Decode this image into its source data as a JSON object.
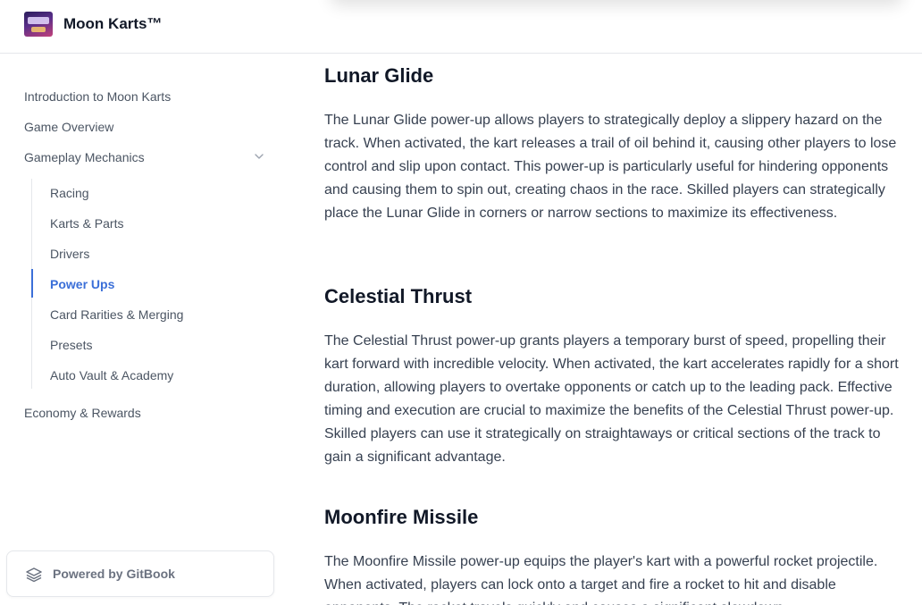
{
  "header": {
    "site_title": "Moon Karts™",
    "logo_icon": "moon-karts-logo"
  },
  "sidebar": {
    "items": [
      {
        "label": "Introduction to Moon Karts"
      },
      {
        "label": "Game Overview"
      },
      {
        "label": "Gameplay Mechanics",
        "expanded": true
      },
      {
        "label": "Economy & Rewards"
      }
    ],
    "subitems": [
      {
        "label": "Racing"
      },
      {
        "label": "Karts & Parts"
      },
      {
        "label": "Drivers"
      },
      {
        "label": "Power Ups",
        "active": true
      },
      {
        "label": "Card Rarities & Merging"
      },
      {
        "label": "Presets"
      },
      {
        "label": "Auto Vault & Academy"
      }
    ],
    "gitbook_label": "Powered by GitBook"
  },
  "content": {
    "sections": [
      {
        "heading": "Lunar Glide",
        "text": "The Lunar Glide power-up allows players to strategically deploy a slippery hazard on the track. When activated, the kart releases a trail of oil behind it, causing other players to lose control and slip upon contact. This power-up is particularly useful for hindering opponents and causing them to spin out, creating chaos in the race. Skilled players can strategically place the Lunar Glide in corners or narrow sections to maximize its effectiveness."
      },
      {
        "heading": "Celestial Thrust",
        "text": "The Celestial Thrust power-up grants players a temporary burst of speed, propelling their kart forward with incredible velocity. When activated, the kart accelerates rapidly for a short duration, allowing players to overtake opponents or catch up to the leading pack. Effective timing and execution are crucial to maximize the benefits of the Celestial Thrust power-up. Skilled players can use it strategically on straightaways or critical sections of the track to gain a significant advantage."
      },
      {
        "heading": "Moonfire Missile",
        "text": "The Moonfire Missile power-up equips the player's kart with a powerful rocket projectile. When activated, players can lock onto a target and fire a rocket to hit and disable opponents. The rocket travels quickly and causes a significant slowdown"
      }
    ]
  },
  "colors": {
    "accent": "#3b6fd8",
    "text": "#374151",
    "heading": "#111827",
    "muted": "#4b5563",
    "border": "#e5e7eb"
  }
}
